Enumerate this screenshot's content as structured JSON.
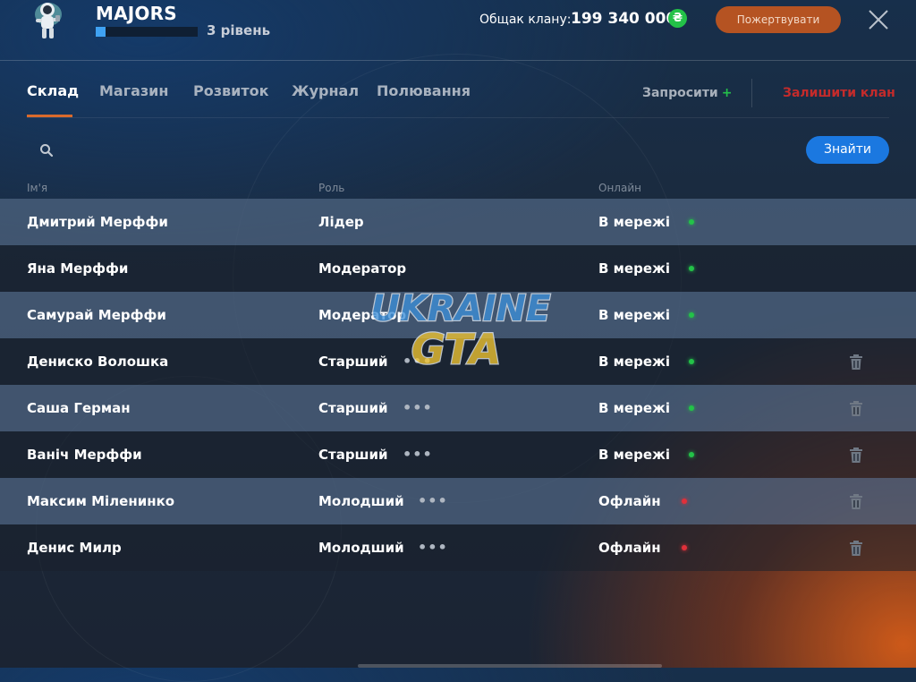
{
  "clan": {
    "name": "MAJORS",
    "level_text": "3 рівень",
    "level_progress": 0.1
  },
  "bank": {
    "label": "Общак клану:",
    "value": "199 340 000",
    "currency_icon": "coin-icon",
    "currency_glyph": "₴",
    "currency_color": "#23c248"
  },
  "actions": {
    "donate_label": "Пожертвувати",
    "invite_label": "Запросити",
    "invite_plus": "+",
    "leave_label": "Залишити клан",
    "find_label": "Знайти"
  },
  "tabs": [
    {
      "label": "Склад",
      "active": true
    },
    {
      "label": "Магазин",
      "active": false
    },
    {
      "label": "Розвиток",
      "active": false
    },
    {
      "label": "Журнал",
      "active": false
    },
    {
      "label": "Полювання",
      "active": false
    }
  ],
  "search": {
    "value": "",
    "placeholder": ""
  },
  "columns": {
    "name": "Ім'я",
    "role": "Роль",
    "online": "Онлайн"
  },
  "members": [
    {
      "name": "Дмитрий Мерффи",
      "role": "Лідер",
      "status": "В мережі",
      "online": true,
      "menu": false,
      "delete": false
    },
    {
      "name": "Яна Мерффи",
      "role": "Модератор",
      "status": "В мережі",
      "online": true,
      "menu": false,
      "delete": false
    },
    {
      "name": "Самурай Мерффи",
      "role": "Модератор",
      "status": "В мережі",
      "online": true,
      "menu": false,
      "delete": false
    },
    {
      "name": "Дениско Волошка",
      "role": "Старший",
      "status": "В мережі",
      "online": true,
      "menu": true,
      "delete": true
    },
    {
      "name": "Саша Герман",
      "role": "Старший",
      "status": "В мережі",
      "online": true,
      "menu": true,
      "delete": true
    },
    {
      "name": "Ваніч Мерффи",
      "role": "Старший",
      "status": "В мережі",
      "online": true,
      "menu": true,
      "delete": true
    },
    {
      "name": "Максим Міленинко",
      "role": "Молодший",
      "status": "Офлайн",
      "online": false,
      "menu": true,
      "delete": true
    },
    {
      "name": "Денис Милр",
      "role": "Молодший",
      "status": "Офлайн",
      "online": false,
      "menu": true,
      "delete": true
    }
  ],
  "colors": {
    "accent_orange": "#d96a2c",
    "online": "#23c248",
    "offline": "#e0303a",
    "leave": "#c42b2b",
    "find_button": "#1b78e0"
  },
  "watermark": {
    "line1": "UKRAINE",
    "line2": "GTA"
  }
}
